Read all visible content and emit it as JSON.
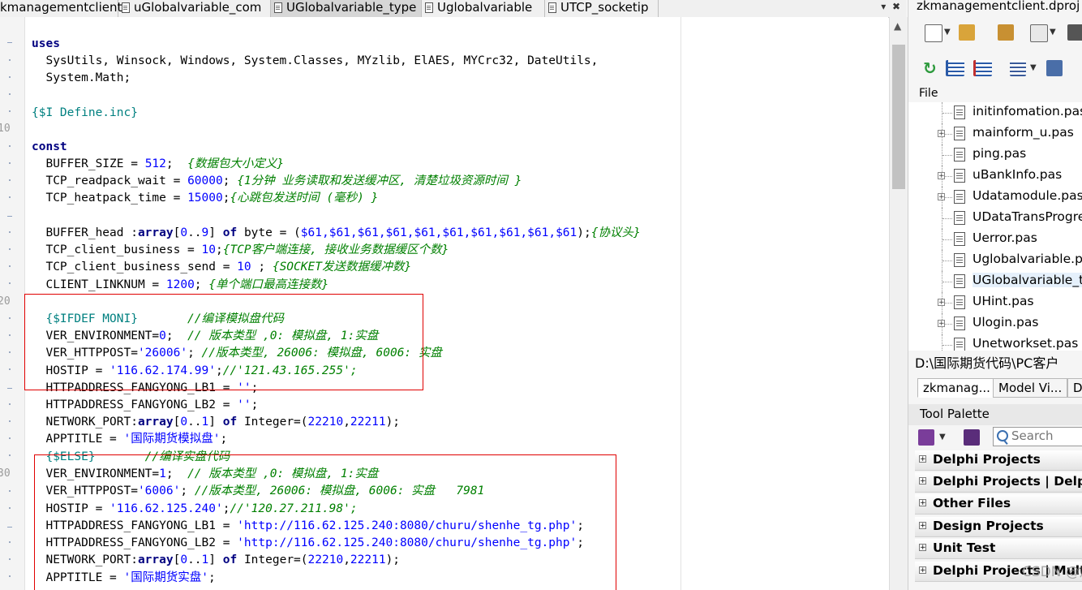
{
  "editor_tabs": [
    {
      "label": "kmanagementclient",
      "active": false
    },
    {
      "label": "uGlobalvariable_com",
      "active": false
    },
    {
      "label": "UGlobalvariable_type",
      "active": true
    },
    {
      "label": "Uglobalvariable",
      "active": false
    },
    {
      "label": "UTCP_socketip",
      "active": false
    }
  ],
  "tab_controls": {
    "dropdown": "▾",
    "close": "✖"
  },
  "gutter": {
    "line_10": "10",
    "line_20": "20",
    "line_30": "30"
  },
  "code": {
    "l1": "uses",
    "l2": "  SysUtils, Winsock, Windows, System.Classes, MYzlib, ElAES, MYCrc32, DateUtils,",
    "l3": "  System.Math;",
    "l5": "{$I Define.inc}",
    "l7": "const",
    "l8a": "  BUFFER_SIZE = ",
    "l8n": "512",
    "l8b": ";  ",
    "l8c": "{数据包大小定义}",
    "l9a": "  TCP_readpack_wait = ",
    "l9n": "60000",
    "l9b": "; ",
    "l9c": "{1分钟 业务读取和发送缓冲区, 清楚垃圾资源时间 }",
    "l10a": "  TCP_heatpack_time = ",
    "l10n": "15000",
    "l10b": ";",
    "l10c": "{心跳包发送时间 (毫秒) }",
    "l12a": "  BUFFER_head :",
    "l12k1": "array",
    "l12b": "[",
    "l12n1": "0",
    "l12c": "..",
    "l12n2": "9",
    "l12d": "] ",
    "l12k2": "of",
    "l12e": " byte = (",
    "l12n3": "$61,$61,$61,$61,$61,$61,$61,$61,$61,$61",
    "l12f": ");",
    "l12cm": "{协议头}",
    "l13a": "  TCP_client_business = ",
    "l13n": "10",
    "l13b": ";",
    "l13c": "{TCP客户端连接, 接收业务数据缓区个数}",
    "l14a": "  TCP_client_business_send = ",
    "l14n": "10",
    "l14b": " ; ",
    "l14c": "{SOCKET发送数据缓冲数}",
    "l15a": "  CLIENT_LINKNUM = ",
    "l15n": "1200",
    "l15b": "; ",
    "l15c": "{单个端口最高连接数}",
    "l17d": "  {$IFDEF MONI}",
    "l17c": "       //编译模拟盘代码",
    "l18a": "  VER_ENVIRONMENT=",
    "l18n": "0",
    "l18b": ";  ",
    "l18c": "// 版本类型 ,0: 模拟盘, 1:实盘",
    "l19a": "  VER_HTTPPOST=",
    "l19s": "'26006'",
    "l19b": "; ",
    "l19c": "//版本类型, 26006: 模拟盘, 6006: 实盘",
    "l20a": "  HOSTIP = ",
    "l20s": "'116.62.174.99'",
    "l20b": ";",
    "l20c": "//'121.43.165.255';",
    "l21a": "  HTTPADDRESS_FANGYONG_LB1 = ",
    "l21s": "''",
    "l21b": ";",
    "l22a": "  HTTPADDRESS_FANGYONG_LB2 = ",
    "l22s": "''",
    "l22b": ";",
    "l23a": "  NETWORK_PORT:",
    "l23k1": "array",
    "l23b": "[",
    "l23n1": "0",
    "l23c": "..",
    "l23n2": "1",
    "l23d": "] ",
    "l23k2": "of",
    "l23e": " Integer=(",
    "l23n3": "22210",
    "l23f": ",",
    "l23n4": "22211",
    "l23g": ");",
    "l24a": "  APPTITLE = ",
    "l24s": "'国际期货模拟盘'",
    "l24b": ";",
    "l25d": "  {$ELSE}",
    "l25c": "       //编译实盘代码",
    "l26a": "  VER_ENVIRONMENT=",
    "l26n": "1",
    "l26b": ";  ",
    "l26c": "// 版本类型 ,0: 模拟盘, 1:实盘",
    "l27a": "  VER_HTTPPOST=",
    "l27s": "'6006'",
    "l27b": "; ",
    "l27c": "//版本类型, 26006: 模拟盘, 6006: 实盘   7981",
    "l28a": "  HOSTIP = ",
    "l28s": "'116.62.125.240'",
    "l28b": ";",
    "l28c": "//'120.27.211.98';",
    "l29a": "  HTTPADDRESS_FANGYONG_LB1 = ",
    "l29s": "'http://116.62.125.240:8080/churu/shenhe_tg.php'",
    "l29b": ";",
    "l30a": "  HTTPADDRESS_FANGYONG_LB2 = ",
    "l30s": "'http://116.62.125.240:8080/churu/shenhe_tg.php'",
    "l30b": ";",
    "l31a": "  NETWORK_PORT:",
    "l31k1": "array",
    "l31b": "[",
    "l31n1": "0",
    "l31c": "..",
    "l31n2": "1",
    "l31d": "] ",
    "l31k2": "of",
    "l31e": " Integer=(",
    "l31n3": "22210",
    "l31f": ",",
    "l31n4": "22211",
    "l31g": ");",
    "l32a": "  APPTITLE = ",
    "l32s": "'国际期货实盘'",
    "l32b": ";"
  },
  "colors": {
    "keyword": "#000080",
    "number": "#0000ff",
    "string": "#0000ff",
    "comment": "#008000",
    "directive": "#008080",
    "highlight_box": "#e00000"
  },
  "project_panel": {
    "title": "zkmanagementclient.dproj -",
    "file_header": "File",
    "files": [
      {
        "label": "initinfomation.pas",
        "expandable": false
      },
      {
        "label": "mainform_u.pas",
        "expandable": true
      },
      {
        "label": "ping.pas",
        "expandable": false
      },
      {
        "label": "uBankInfo.pas",
        "expandable": true
      },
      {
        "label": "Udatamodule.pas",
        "expandable": true
      },
      {
        "label": "UDataTransProgress",
        "expandable": false
      },
      {
        "label": "Uerror.pas",
        "expandable": false
      },
      {
        "label": "Uglobalvariable.pas",
        "expandable": false
      },
      {
        "label": "UGlobalvariable_type",
        "expandable": false
      },
      {
        "label": "UHint.pas",
        "expandable": true
      },
      {
        "label": "Ulogin.pas",
        "expandable": true
      },
      {
        "label": "Unetworkset.pas",
        "expandable": false
      }
    ],
    "path": "D:\\国际期货代码\\PC客户",
    "tabs": [
      "zkmanag...",
      "Model Vi...",
      "D"
    ]
  },
  "tool_palette": {
    "title": "Tool Palette",
    "search_placeholder": "Search",
    "categories": [
      "Delphi Projects",
      "Delphi Projects | Delphi",
      "Other Files",
      "Design Projects",
      "Unit Test",
      "Delphi Projects | Multi"
    ]
  },
  "watermark": "CSDN @炼梦"
}
